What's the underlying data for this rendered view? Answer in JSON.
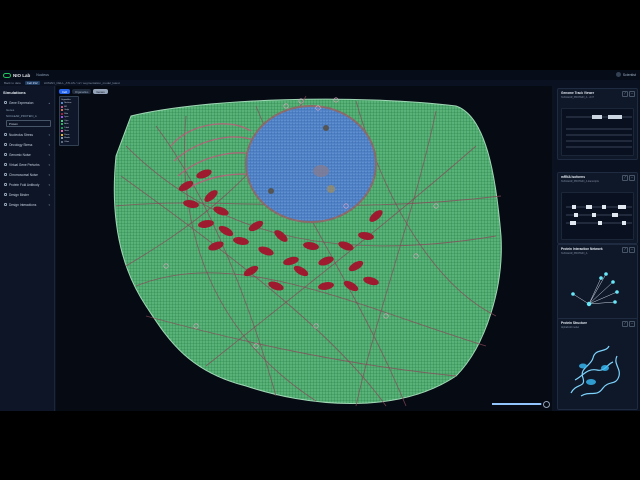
{
  "app": {
    "name": "NIO Lab",
    "project": "Nucleus"
  },
  "user": {
    "name": "Scientist"
  },
  "breadcrumb": {
    "back": "Back to data",
    "tag": "Cell #12",
    "path": "HUMAN_CELL_ATLAS / v2 / segmentation_model_latest"
  },
  "sidebar": {
    "title": "Simulations",
    "items": [
      {
        "label": "Gene Expression"
      },
      {
        "label": "Nucleolus Stress"
      },
      {
        "label": "Oncology Stress"
      },
      {
        "label": "Genomic Noise"
      },
      {
        "label": "Virtual Gene Perturbs"
      },
      {
        "label": "Chromosomal Noise"
      },
      {
        "label": "Protein Fold Antibody"
      },
      {
        "label": "Design Binder"
      },
      {
        "label": "Design Interactions"
      }
    ],
    "panel_label": "Genes",
    "panel_value": "NUCLEAR_PROTEIN_A",
    "input_value": "Protein"
  },
  "viewer": {
    "tabs": [
      "Cell",
      "Organelles",
      "Genes"
    ],
    "legend_title": "Organelles",
    "legend": [
      {
        "label": "Nucleus",
        "color": "#5b8fd6"
      },
      {
        "label": "ER",
        "color": "#d45a8a"
      },
      {
        "label": "Golgi",
        "color": "#e07b5a"
      },
      {
        "label": "Mito",
        "color": "#b3203a"
      },
      {
        "label": "Lyso",
        "color": "#a855f7"
      },
      {
        "label": "Cyto",
        "color": "#4ade80"
      },
      {
        "label": "Actin",
        "color": "#22c55e"
      },
      {
        "label": "Tubul",
        "color": "#16a34a"
      },
      {
        "label": "Vesic",
        "color": "#f472b6"
      },
      {
        "label": "Perox",
        "color": "#fbbf24"
      },
      {
        "label": "Memb",
        "color": "#94a3b8"
      },
      {
        "label": "Other",
        "color": "#64748b"
      }
    ],
    "zoom_fraction": 0.98
  },
  "right": {
    "cards": [
      {
        "title": "Genome Track Viewer",
        "subtitle": "NUCLEAR_PROTEIN_A · chr7"
      },
      {
        "title": "mRNA Isoforms",
        "subtitle": "NUCLEAR_PROTEIN_A transcripts"
      },
      {
        "title": "Protein Interaction Network",
        "subtitle": "NUCLEAR_PROTEIN_A"
      },
      {
        "title": "Protein Structure",
        "subtitle": "AlphaFold model"
      }
    ]
  }
}
